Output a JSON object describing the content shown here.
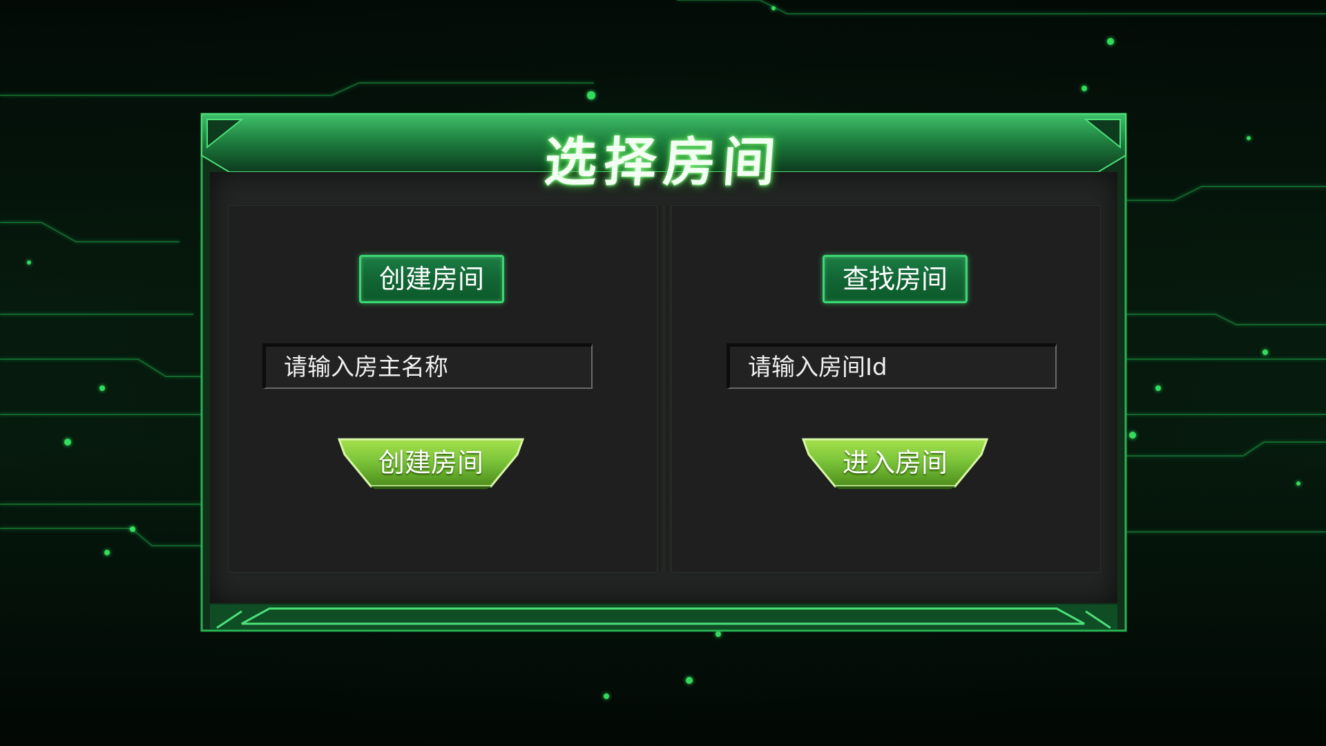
{
  "title": "选择房间",
  "create_section": {
    "tag_label": "创建房间",
    "input_placeholder": "请输入房主名称",
    "button_label": "创建房间"
  },
  "join_section": {
    "tag_label": "查找房间",
    "input_placeholder": "请输入房间Id",
    "button_label": "进入房间"
  },
  "colors": {
    "accent_green": "#3ad873",
    "button_green": "#7cc53a",
    "panel_bg": "#222523",
    "title_glow": "#3cd83c"
  }
}
